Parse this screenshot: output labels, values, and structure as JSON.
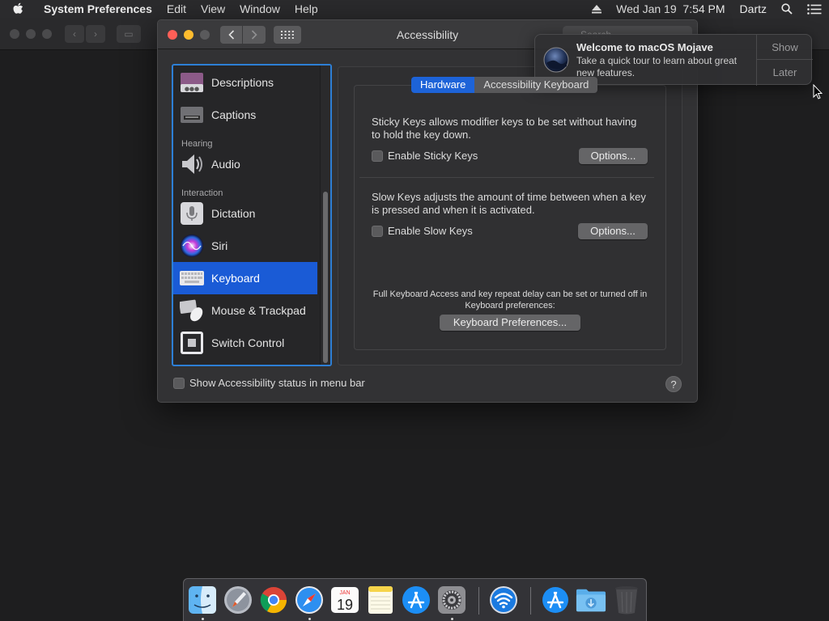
{
  "menubar": {
    "app_name": "System Preferences",
    "menus": [
      "Edit",
      "View",
      "Window",
      "Help"
    ],
    "datetime": "Wed Jan 19  7:54 PM",
    "user": "Dartz"
  },
  "window": {
    "title": "Accessibility",
    "search_placeholder": "Search"
  },
  "sidebar": {
    "items": [
      {
        "type": "item",
        "label": "Descriptions",
        "icon": "descriptions-icon"
      },
      {
        "type": "item",
        "label": "Captions",
        "icon": "captions-icon"
      },
      {
        "type": "header",
        "label": "Hearing"
      },
      {
        "type": "item",
        "label": "Audio",
        "icon": "speaker-icon"
      },
      {
        "type": "header",
        "label": "Interaction"
      },
      {
        "type": "item",
        "label": "Dictation",
        "icon": "microphone-icon"
      },
      {
        "type": "item",
        "label": "Siri",
        "icon": "siri-icon"
      },
      {
        "type": "item",
        "label": "Keyboard",
        "icon": "keyboard-icon",
        "selected": true
      },
      {
        "type": "item",
        "label": "Mouse & Trackpad",
        "icon": "mouse-trackpad-icon"
      },
      {
        "type": "item",
        "label": "Switch Control",
        "icon": "switch-control-icon"
      }
    ]
  },
  "tabs": [
    {
      "label": "Hardware",
      "active": true
    },
    {
      "label": "Accessibility Keyboard",
      "active": false
    }
  ],
  "sticky_keys": {
    "description": "Sticky Keys allows modifier keys to be set without having to hold the key down.",
    "checkbox_label": "Enable Sticky Keys",
    "checked": false,
    "options_label": "Options..."
  },
  "slow_keys": {
    "description": "Slow Keys adjusts the amount of time between when a key is pressed and when it is activated.",
    "checkbox_label": "Enable Slow Keys",
    "checked": false,
    "options_label": "Options..."
  },
  "keyboard_prefs": {
    "note": "Full Keyboard Access and key repeat delay can be set or turned off in Keyboard preferences:",
    "button_label": "Keyboard Preferences..."
  },
  "footer": {
    "status_checkbox_label": "Show Accessibility status in menu bar",
    "checked": false,
    "help_label": "?"
  },
  "notification": {
    "title": "Welcome to macOS Mojave",
    "body": "Take a quick tour to learn about great new features.",
    "action_show": "Show",
    "action_later": "Later"
  },
  "dock": {
    "apps": [
      {
        "name": "Finder",
        "icon": "finder-icon",
        "running": true
      },
      {
        "name": "Launchpad",
        "icon": "launchpad-icon",
        "running": false
      },
      {
        "name": "Chrome",
        "icon": "chrome-icon",
        "running": false
      },
      {
        "name": "Safari",
        "icon": "safari-icon",
        "running": true
      },
      {
        "name": "Calendar",
        "icon": "calendar-icon",
        "running": false,
        "month": "JAN",
        "day": "19"
      },
      {
        "name": "Notes",
        "icon": "notes-icon",
        "running": false
      },
      {
        "name": "App Store",
        "icon": "app-store-icon",
        "running": false
      },
      {
        "name": "System Preferences",
        "icon": "system-preferences-icon",
        "running": true
      },
      {
        "name": "Wireless Diagnostics",
        "icon": "wifi-icon",
        "running": false
      },
      {
        "name": "Applications",
        "icon": "applications-folder-icon",
        "running": false
      },
      {
        "name": "Downloads",
        "icon": "downloads-folder-icon",
        "running": false
      },
      {
        "name": "Trash",
        "icon": "trash-icon",
        "running": false
      }
    ]
  },
  "colors": {
    "accent": "#1a5bd6",
    "close": "#fe5f57",
    "minimize": "#febc2e"
  }
}
